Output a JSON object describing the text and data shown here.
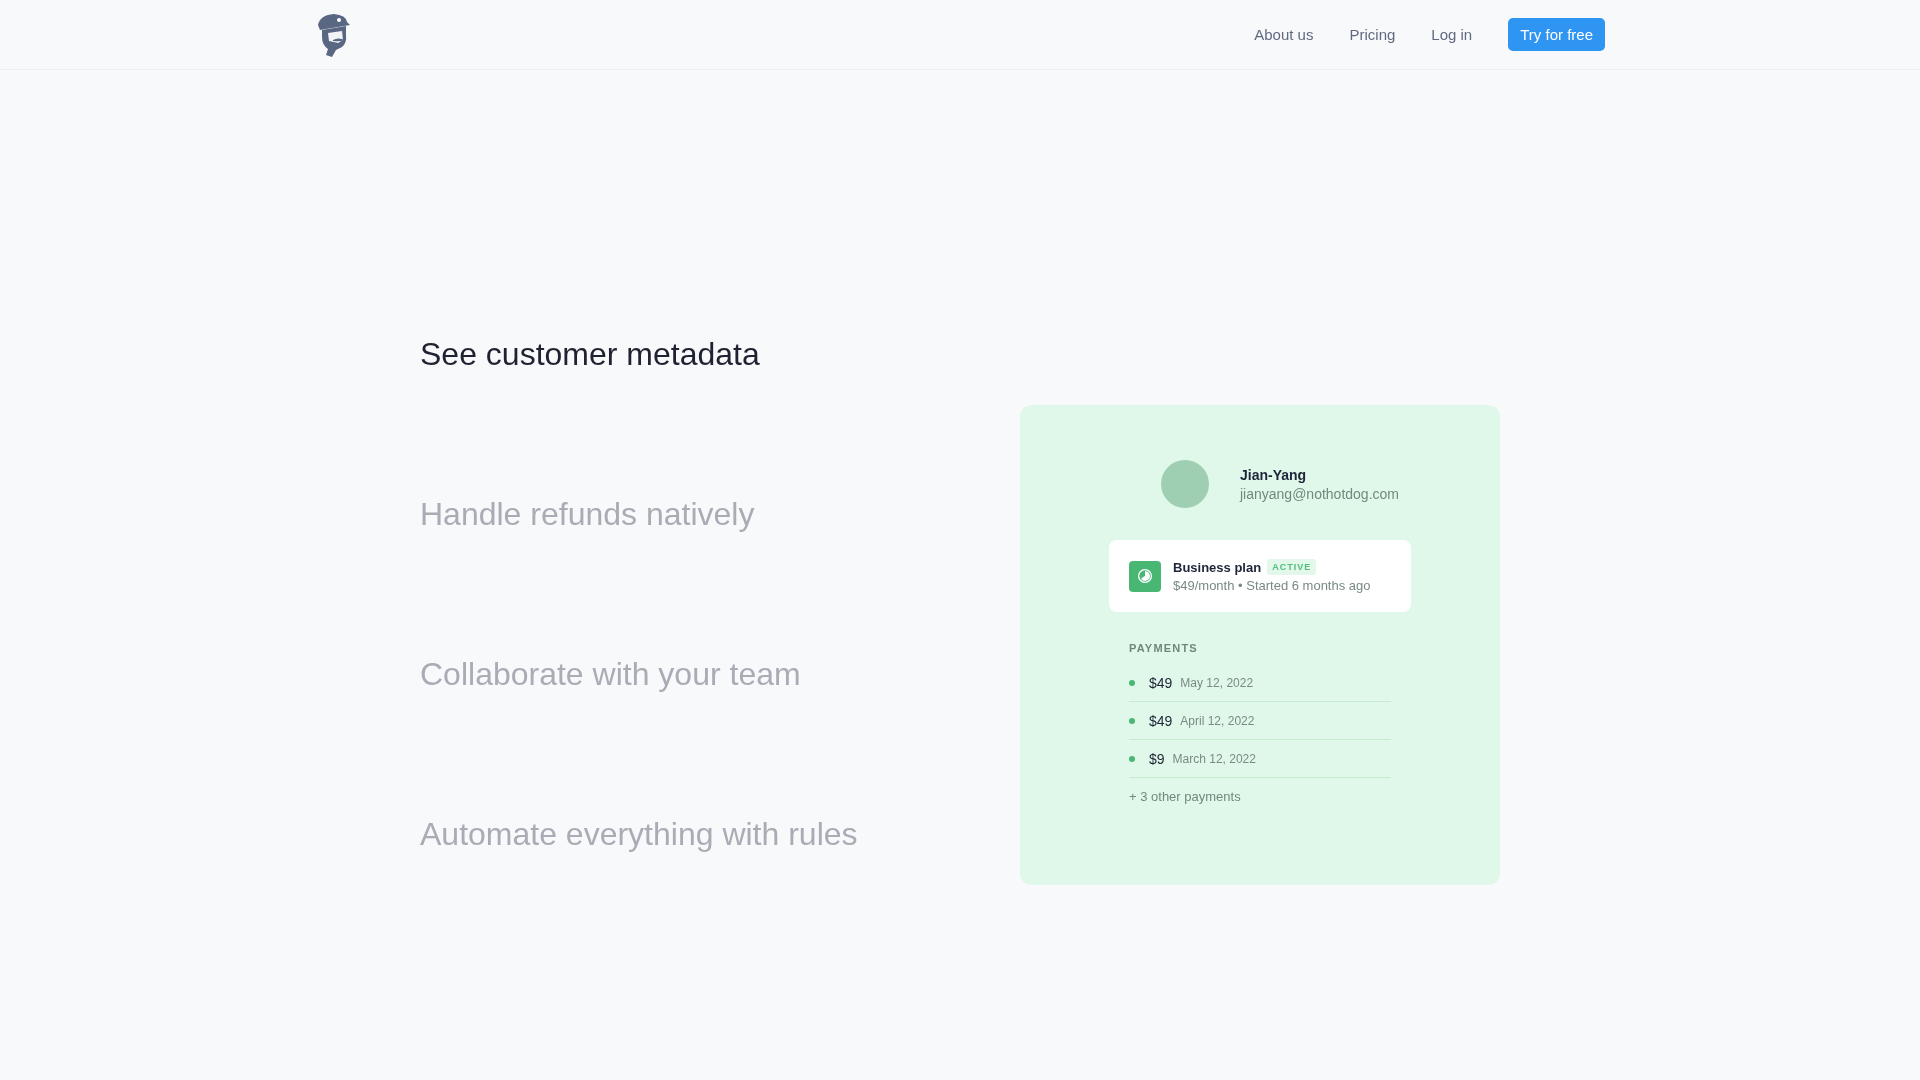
{
  "nav": {
    "links": [
      "About us",
      "Pricing",
      "Log in"
    ],
    "cta": "Try for free"
  },
  "features": [
    {
      "title": "See customer metadata",
      "selected": true
    },
    {
      "title": "Handle refunds natively",
      "selected": false
    },
    {
      "title": "Collaborate with your team",
      "selected": false
    },
    {
      "title": "Automate everything with rules",
      "selected": false
    }
  ],
  "customer": {
    "name": "Jian-Yang",
    "email": "jianyang@nothotdog.com"
  },
  "plan": {
    "name": "Business plan",
    "badge": "ACTIVE",
    "details": "$49/month • Started 6 months ago"
  },
  "payments": {
    "heading": "PAYMENTS",
    "items": [
      {
        "amount": "$49",
        "date": "May 12, 2022"
      },
      {
        "amount": "$49",
        "date": "April 12, 2022"
      },
      {
        "amount": "$9",
        "date": "March 12, 2022"
      }
    ],
    "more": "+ 3 other payments"
  }
}
